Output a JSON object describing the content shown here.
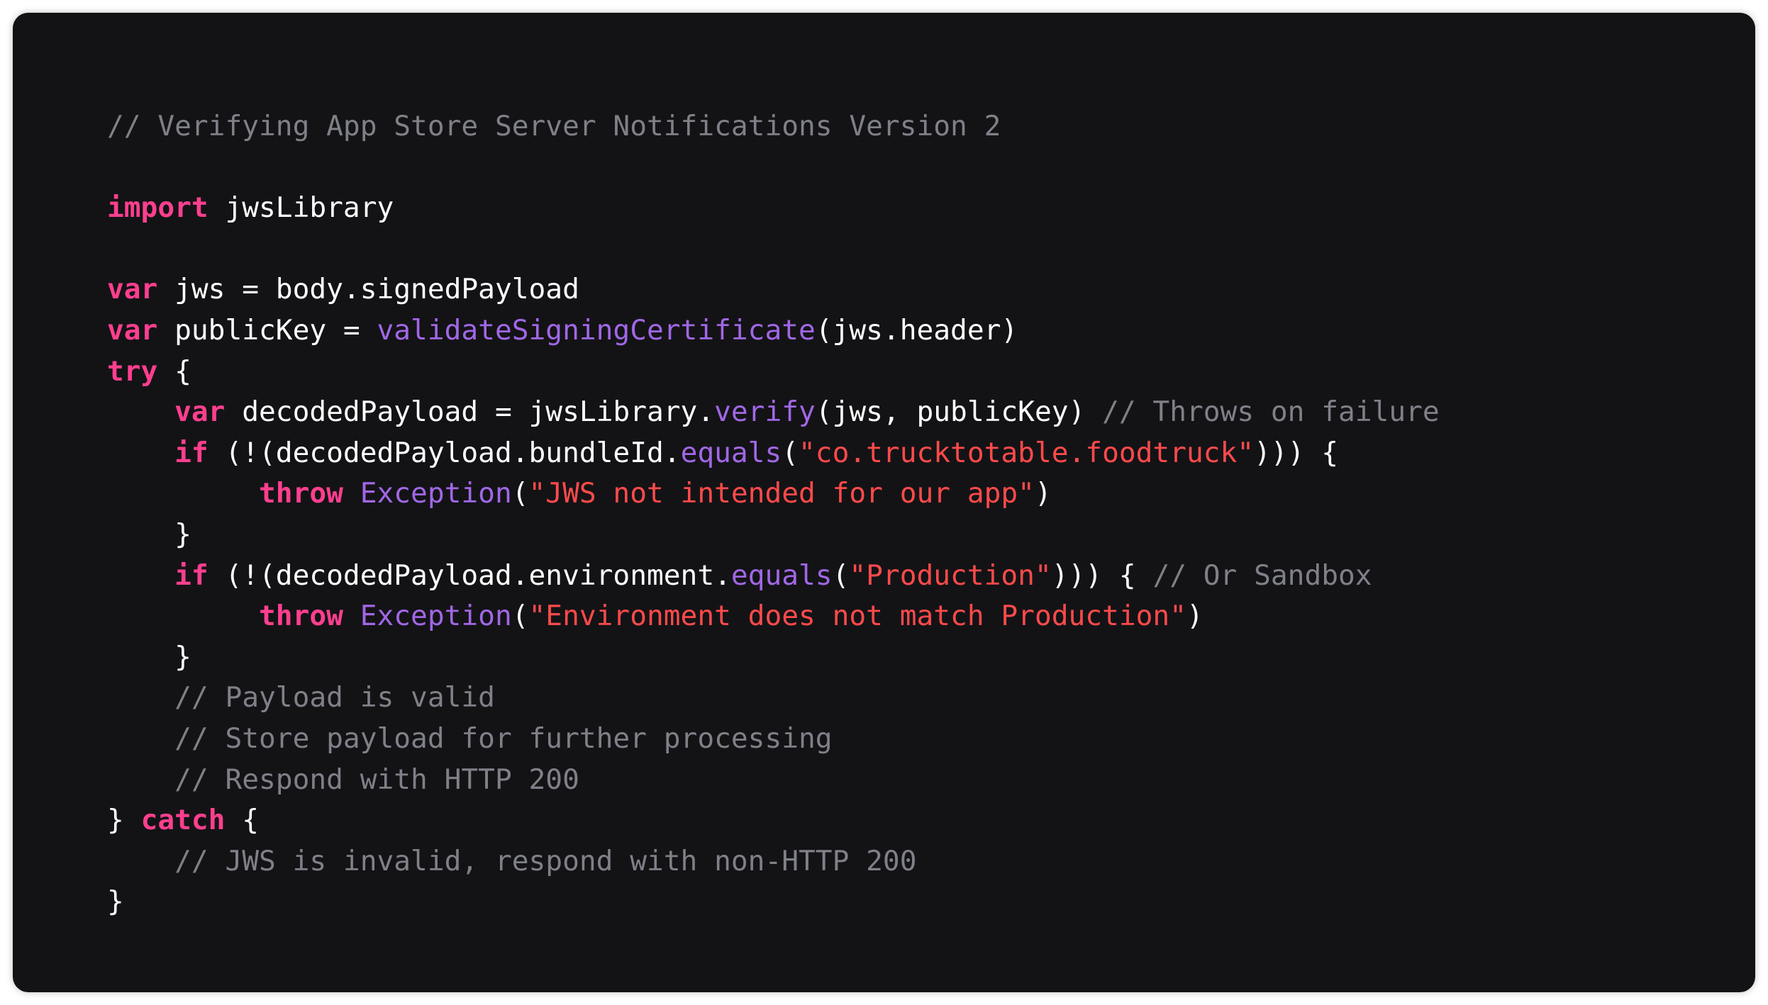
{
  "colors": {
    "background": "#131316",
    "comment": "#7f8088",
    "keyword": "#ff3f8e",
    "function": "#a167e6",
    "string": "#ff4a4a",
    "plain": "#ffffff"
  },
  "code": {
    "lines": [
      [
        {
          "t": "comment",
          "v": "// Verifying App Store Server Notifications Version 2"
        }
      ],
      [],
      [
        {
          "t": "keyword",
          "v": "import"
        },
        {
          "t": "plain",
          "v": " jwsLibrary"
        }
      ],
      [],
      [
        {
          "t": "keyword",
          "v": "var"
        },
        {
          "t": "plain",
          "v": " jws = body.signedPayload"
        }
      ],
      [
        {
          "t": "keyword",
          "v": "var"
        },
        {
          "t": "plain",
          "v": " publicKey = "
        },
        {
          "t": "func",
          "v": "validateSigningCertificate"
        },
        {
          "t": "plain",
          "v": "(jws.header)"
        }
      ],
      [
        {
          "t": "keyword",
          "v": "try"
        },
        {
          "t": "plain",
          "v": " {"
        }
      ],
      [
        {
          "t": "plain",
          "v": "    "
        },
        {
          "t": "keyword",
          "v": "var"
        },
        {
          "t": "plain",
          "v": " decodedPayload = jwsLibrary."
        },
        {
          "t": "func",
          "v": "verify"
        },
        {
          "t": "plain",
          "v": "(jws, publicKey) "
        },
        {
          "t": "comment",
          "v": "// Throws on failure"
        }
      ],
      [
        {
          "t": "plain",
          "v": "    "
        },
        {
          "t": "keyword",
          "v": "if"
        },
        {
          "t": "plain",
          "v": " (!(decodedPayload.bundleId."
        },
        {
          "t": "func",
          "v": "equals"
        },
        {
          "t": "plain",
          "v": "("
        },
        {
          "t": "string",
          "v": "\"co.trucktotable.foodtruck\""
        },
        {
          "t": "plain",
          "v": "))) {"
        }
      ],
      [
        {
          "t": "plain",
          "v": "         "
        },
        {
          "t": "keyword",
          "v": "throw"
        },
        {
          "t": "plain",
          "v": " "
        },
        {
          "t": "func",
          "v": "Exception"
        },
        {
          "t": "plain",
          "v": "("
        },
        {
          "t": "string",
          "v": "\"JWS not intended for our app\""
        },
        {
          "t": "plain",
          "v": ")"
        }
      ],
      [
        {
          "t": "plain",
          "v": "    }"
        }
      ],
      [
        {
          "t": "plain",
          "v": "    "
        },
        {
          "t": "keyword",
          "v": "if"
        },
        {
          "t": "plain",
          "v": " (!(decodedPayload.environment."
        },
        {
          "t": "func",
          "v": "equals"
        },
        {
          "t": "plain",
          "v": "("
        },
        {
          "t": "string",
          "v": "\"Production\""
        },
        {
          "t": "plain",
          "v": "))) { "
        },
        {
          "t": "comment",
          "v": "// Or Sandbox"
        }
      ],
      [
        {
          "t": "plain",
          "v": "         "
        },
        {
          "t": "keyword",
          "v": "throw"
        },
        {
          "t": "plain",
          "v": " "
        },
        {
          "t": "func",
          "v": "Exception"
        },
        {
          "t": "plain",
          "v": "("
        },
        {
          "t": "string",
          "v": "\"Environment does not match Production\""
        },
        {
          "t": "plain",
          "v": ")"
        }
      ],
      [
        {
          "t": "plain",
          "v": "    }"
        }
      ],
      [
        {
          "t": "plain",
          "v": "    "
        },
        {
          "t": "comment",
          "v": "// Payload is valid"
        }
      ],
      [
        {
          "t": "plain",
          "v": "    "
        },
        {
          "t": "comment",
          "v": "// Store payload for further processing"
        }
      ],
      [
        {
          "t": "plain",
          "v": "    "
        },
        {
          "t": "comment",
          "v": "// Respond with HTTP 200"
        }
      ],
      [
        {
          "t": "plain",
          "v": "} "
        },
        {
          "t": "keyword",
          "v": "catch"
        },
        {
          "t": "plain",
          "v": " {"
        }
      ],
      [
        {
          "t": "plain",
          "v": "    "
        },
        {
          "t": "comment",
          "v": "// JWS is invalid, respond with non-HTTP 200"
        }
      ],
      [
        {
          "t": "plain",
          "v": "}"
        }
      ]
    ]
  }
}
